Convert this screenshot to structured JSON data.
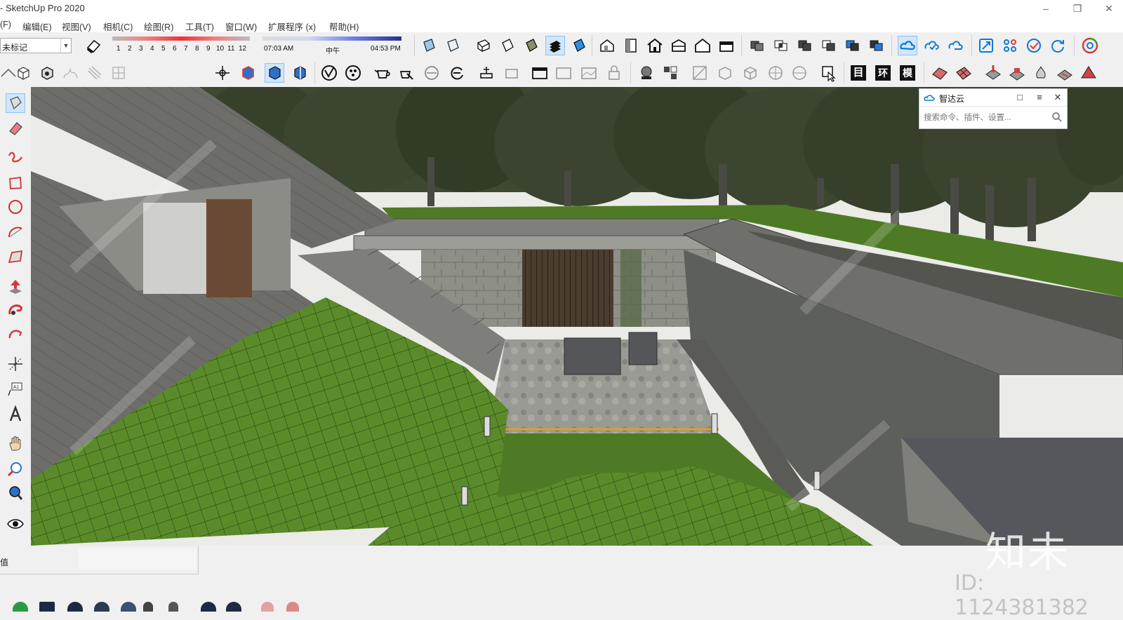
{
  "window": {
    "title": "- SketchUp Pro 2020",
    "controls": [
      "minimize-icon",
      "restore-icon",
      "close-icon"
    ]
  },
  "menu": [
    "(F)",
    "编辑(E)",
    "视图(V)",
    "相机(C)",
    "绘图(R)",
    "工具(T)",
    "窗口(W)",
    "扩展程序 (x)",
    "帮助(H)"
  ],
  "tag_selector": {
    "value": "未标记"
  },
  "shadow": {
    "months": [
      "1",
      "2",
      "3",
      "4",
      "5",
      "6",
      "7",
      "8",
      "9",
      "10",
      "11",
      "12"
    ],
    "time_start": "07:03 AM",
    "time_mid": "中午",
    "time_end": "04:53 PM"
  },
  "panel": {
    "title": "智达云",
    "search_placeholder": "搜索命令、插件、设置...",
    "buttons": [
      "restore-icon",
      "menu-icon",
      "close-icon"
    ]
  },
  "toolbar_text_buttons": [
    "目",
    "环",
    "模"
  ],
  "status": {
    "label": "值"
  },
  "watermark": {
    "brand": "知未",
    "id": "ID: 1124381382"
  },
  "colors": {
    "accent": "#0a7ad8",
    "grass": "#4f7a25",
    "selected": "#cfe6fb"
  }
}
